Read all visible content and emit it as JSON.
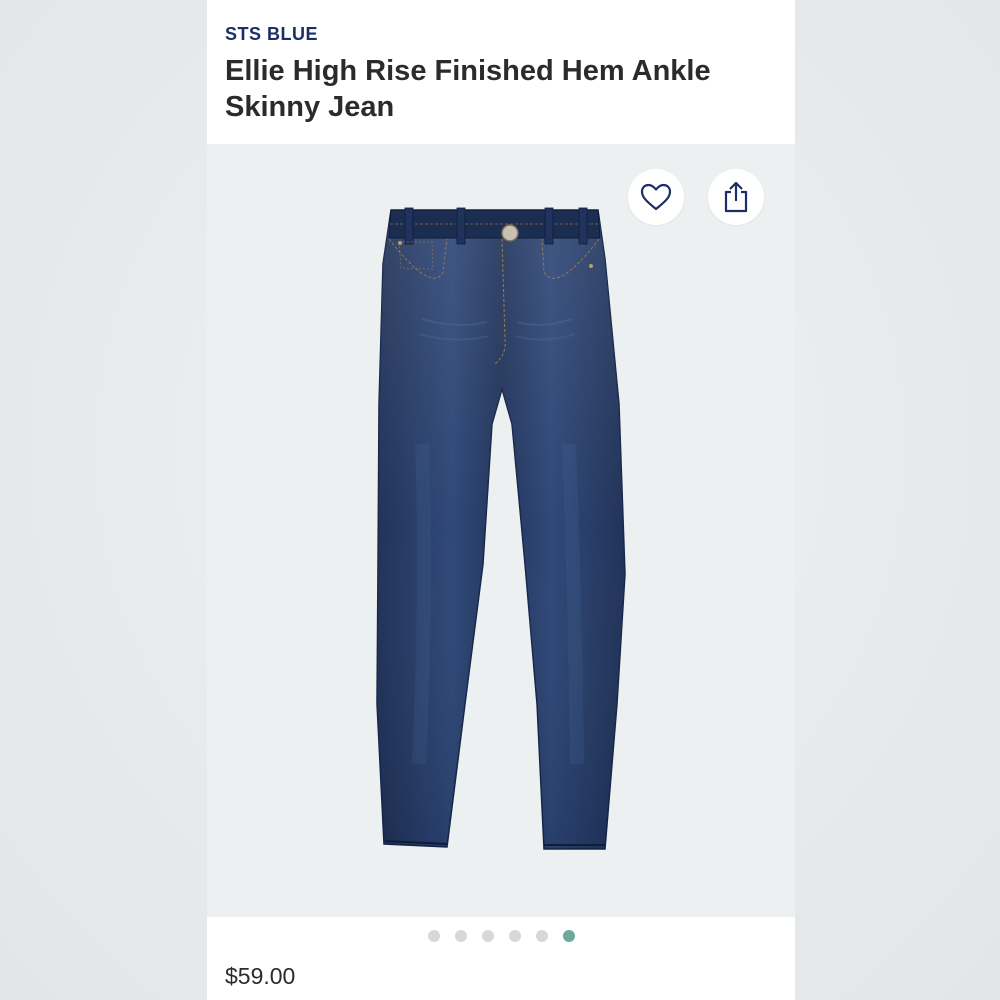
{
  "product": {
    "brand": "STS BLUE",
    "title": "Ellie High Rise Finished Hem Ankle Skinny Jean",
    "price": "$59.00",
    "image_name": "dark-wash-skinny-jeans"
  },
  "actions": {
    "favorite_icon": "heart-icon",
    "share_icon": "share-icon"
  },
  "carousel": {
    "total": 6,
    "active_index": 5
  },
  "colors": {
    "brand": "#1b2f66",
    "denim": "#243a66",
    "active_dot": "#6fa89c",
    "inactive_dot": "#d6d8da",
    "image_bg": "#ecf0f1"
  }
}
